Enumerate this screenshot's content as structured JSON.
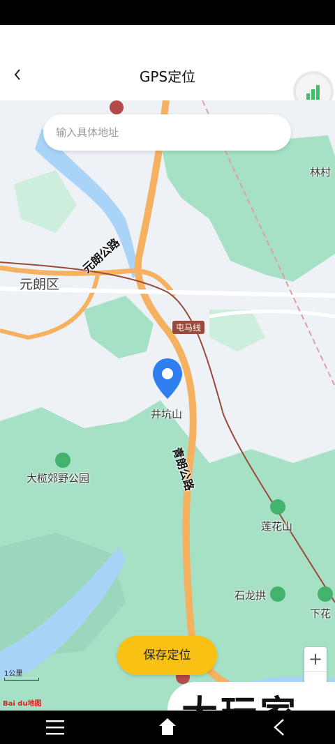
{
  "header": {
    "title": "GPS定位",
    "back_icon": "chevron-left-icon",
    "signal_icon": "signal-bars-icon"
  },
  "search": {
    "placeholder": "输入具体地址"
  },
  "map": {
    "places": {
      "yuen_long_district": "元朗区",
      "lam_tsuen": "林村",
      "tseng_hang_shan": "井坑山",
      "tai_lam_park": "大榄郊野公园",
      "lin_fa_shan": "莲花山",
      "shek_lung_kung": "石龙拱",
      "ha_fa": "下花"
    },
    "roads": {
      "yuen_long_highway": "元朗公路",
      "tsing_long_highway": "青朗公路"
    },
    "rail_line": "屯马线",
    "scale_text": "1公里",
    "logo_text": "Bai du地图"
  },
  "zoom": {
    "in_label": "+",
    "out_label": "−"
  },
  "actions": {
    "save_label": "保存定位"
  },
  "watermark": {
    "text": "大玩家"
  },
  "colors": {
    "accent": "#f9c114",
    "pin": "#2f7ff0",
    "water": "#a9d3f7",
    "green": "#a6e0c5",
    "road": "#f5b060",
    "rail": "#9a4a3a"
  }
}
